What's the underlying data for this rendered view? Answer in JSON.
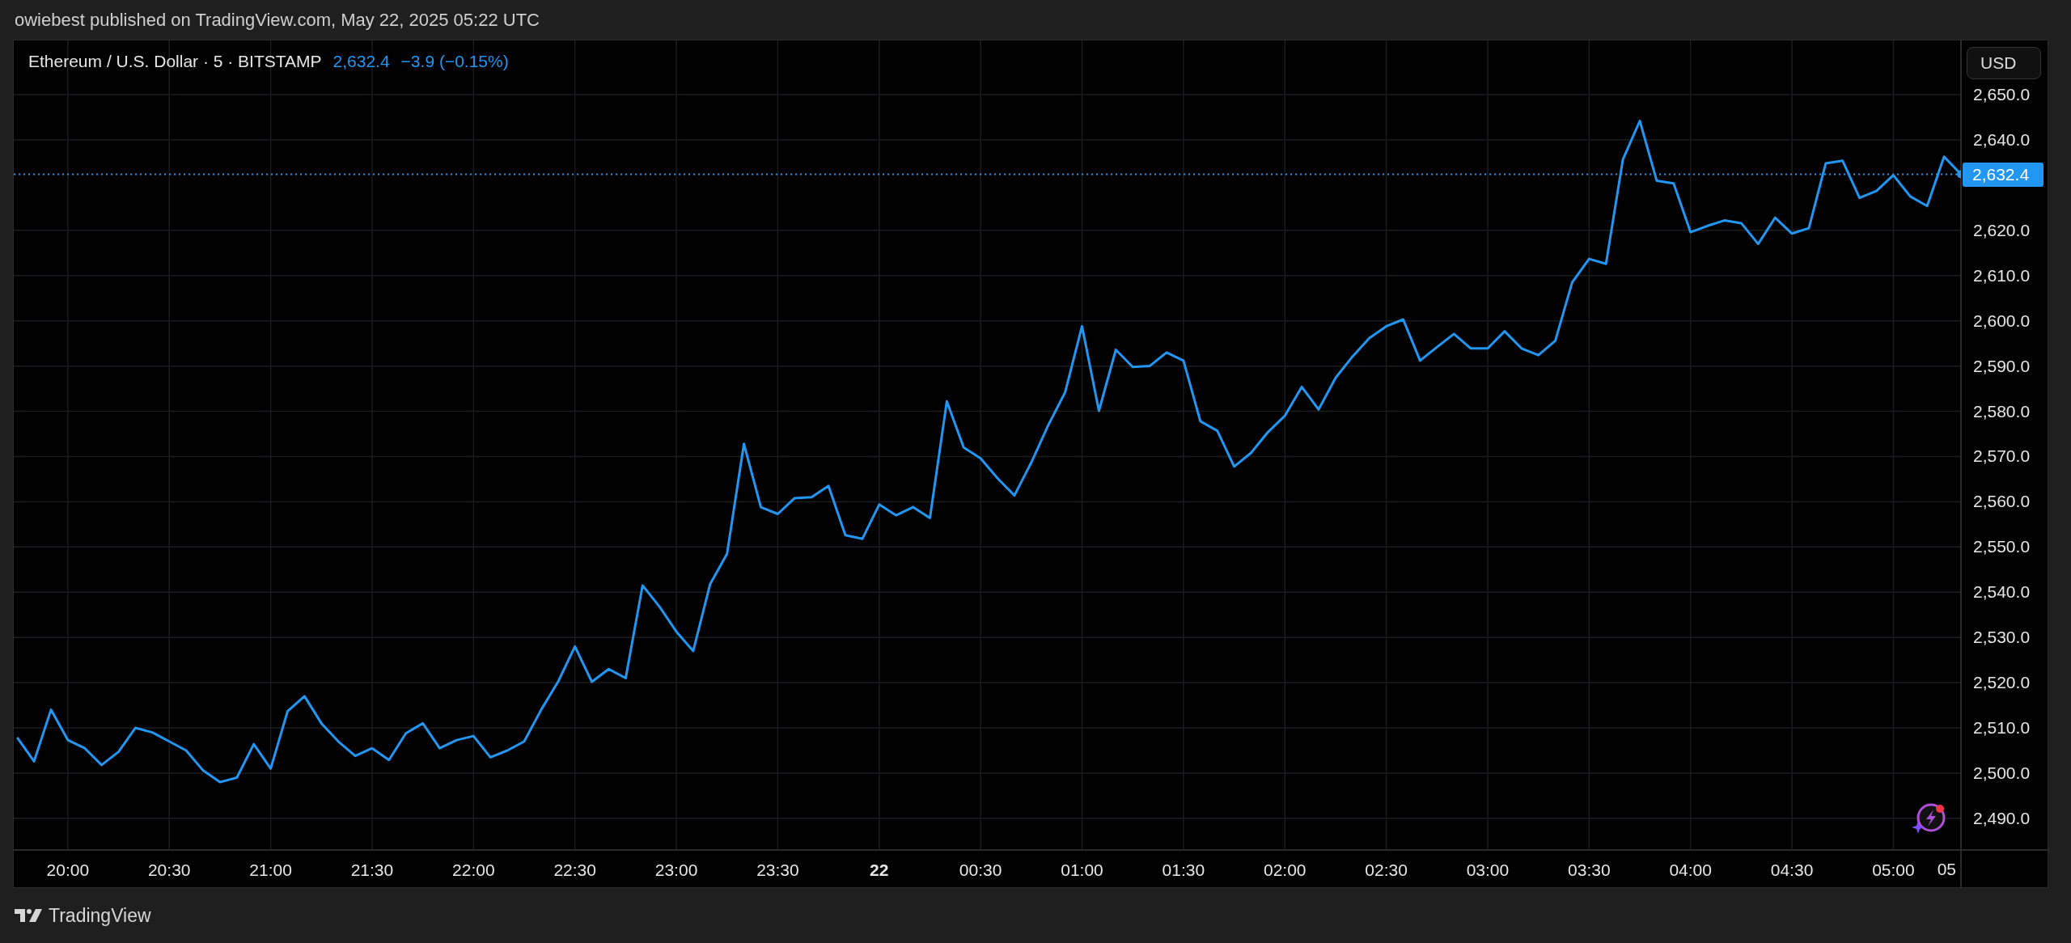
{
  "header": {
    "attribution": "owiebest published on TradingView.com, May 22, 2025 05:22 UTC"
  },
  "chart": {
    "legend": {
      "symbol": "Ethereum / U.S. Dollar · 5 · BITSTAMP",
      "price": "2,632.4",
      "change": "−3.9 (−0.15%)"
    },
    "currency_button": "USD",
    "axis_edge_label": "05",
    "chart_data": {
      "type": "line",
      "grid": true,
      "ylim": [
        2483,
        2662
      ],
      "categories": [
        null,
        null,
        null,
        "20:00",
        null,
        null,
        null,
        null,
        null,
        "20:30",
        null,
        null,
        null,
        null,
        null,
        "21:00",
        null,
        null,
        null,
        null,
        null,
        "21:30",
        null,
        null,
        null,
        null,
        null,
        "22:00",
        null,
        null,
        null,
        null,
        null,
        "22:30",
        null,
        null,
        null,
        null,
        null,
        "23:00",
        null,
        null,
        null,
        null,
        null,
        "23:30",
        null,
        null,
        null,
        null,
        null,
        "22",
        null,
        null,
        null,
        null,
        null,
        "00:30",
        null,
        null,
        null,
        null,
        null,
        "01:00",
        null,
        null,
        null,
        null,
        null,
        "01:30",
        null,
        null,
        null,
        null,
        null,
        "02:00",
        null,
        null,
        null,
        null,
        null,
        "02:30",
        null,
        null,
        null,
        null,
        null,
        "03:00",
        null,
        null,
        null,
        null,
        null,
        "03:30",
        null,
        null,
        null,
        null,
        null,
        "04:00",
        null,
        null,
        null,
        null,
        null,
        "04:30",
        null,
        null,
        null,
        null,
        null,
        "05:00",
        null,
        null,
        null,
        null
      ],
      "yticks": [
        {
          "value": 2490,
          "label": "2,490.0"
        },
        {
          "value": 2500,
          "label": "2,500.0"
        },
        {
          "value": 2510,
          "label": "2,510.0"
        },
        {
          "value": 2520,
          "label": "2,520.0"
        },
        {
          "value": 2530,
          "label": "2,530.0"
        },
        {
          "value": 2540,
          "label": "2,540.0"
        },
        {
          "value": 2550,
          "label": "2,550.0"
        },
        {
          "value": 2560,
          "label": "2,560.0"
        },
        {
          "value": 2570,
          "label": "2,570.0"
        },
        {
          "value": 2580,
          "label": "2,580.0"
        },
        {
          "value": 2590,
          "label": "2,590.0"
        },
        {
          "value": 2600,
          "label": "2,600.0"
        },
        {
          "value": 2610,
          "label": "2,610.0"
        },
        {
          "value": 2620,
          "label": "2,620.0"
        },
        {
          "value": 2640,
          "label": "2,640.0"
        },
        {
          "value": 2650,
          "label": "2,650.0"
        }
      ],
      "ref_lines": [
        {
          "axis": "y",
          "value": 2632.4,
          "label": "2,632.4",
          "color": "#2196f3"
        }
      ],
      "series": [
        {
          "color": "#2196f3",
          "values": [
            2507.9,
            2502.6,
            2514,
            2507.3,
            2505.5,
            2501.8,
            2504.7,
            2510,
            2509,
            2507,
            2505,
            2500.6,
            2498,
            2499,
            2506.4,
            2501,
            2513.7,
            2517,
            2511,
            2507,
            2503.8,
            2505.5,
            2502.9,
            2508.8,
            2511,
            2505.5,
            2507.3,
            2508.2,
            2503.5,
            2505,
            2507,
            2514,
            2520.2,
            2528,
            2520.2,
            2523,
            2521,
            2541.5,
            2536.8,
            2531.3,
            2527,
            2541.8,
            2548.5,
            2572.8,
            2558.8,
            2557.3,
            2560.8,
            2561,
            2563.5,
            2552.6,
            2551.8,
            2559.4,
            2557,
            2558.8,
            2556.4,
            2582.2,
            2572,
            2569.6,
            2565.2,
            2561.4,
            2568.7,
            2576.9,
            2584.2,
            2598.8,
            2580.1,
            2593.6,
            2589.8,
            2590,
            2593,
            2591.2,
            2577.8,
            2575.7,
            2567.8,
            2570.8,
            2575.4,
            2579,
            2585.4,
            2580.4,
            2587.4,
            2592.1,
            2596.2,
            2598.8,
            2600.3,
            2591.2,
            2594.2,
            2597.1,
            2593.9,
            2593.9,
            2597.7,
            2593.9,
            2592.4,
            2595.6,
            2608.5,
            2613.7,
            2612.6,
            2635.7,
            2644.2,
            2631,
            2630.4,
            2619.6,
            2621,
            2622.2,
            2621.6,
            2617,
            2622.8,
            2619.3,
            2620.5,
            2634.8,
            2635.4,
            2627.2,
            2628.7,
            2632.2,
            2627.5,
            2625.4,
            2636.3,
            2632.4
          ]
        }
      ]
    }
  },
  "footer": {
    "logo_text": "TradingView"
  }
}
